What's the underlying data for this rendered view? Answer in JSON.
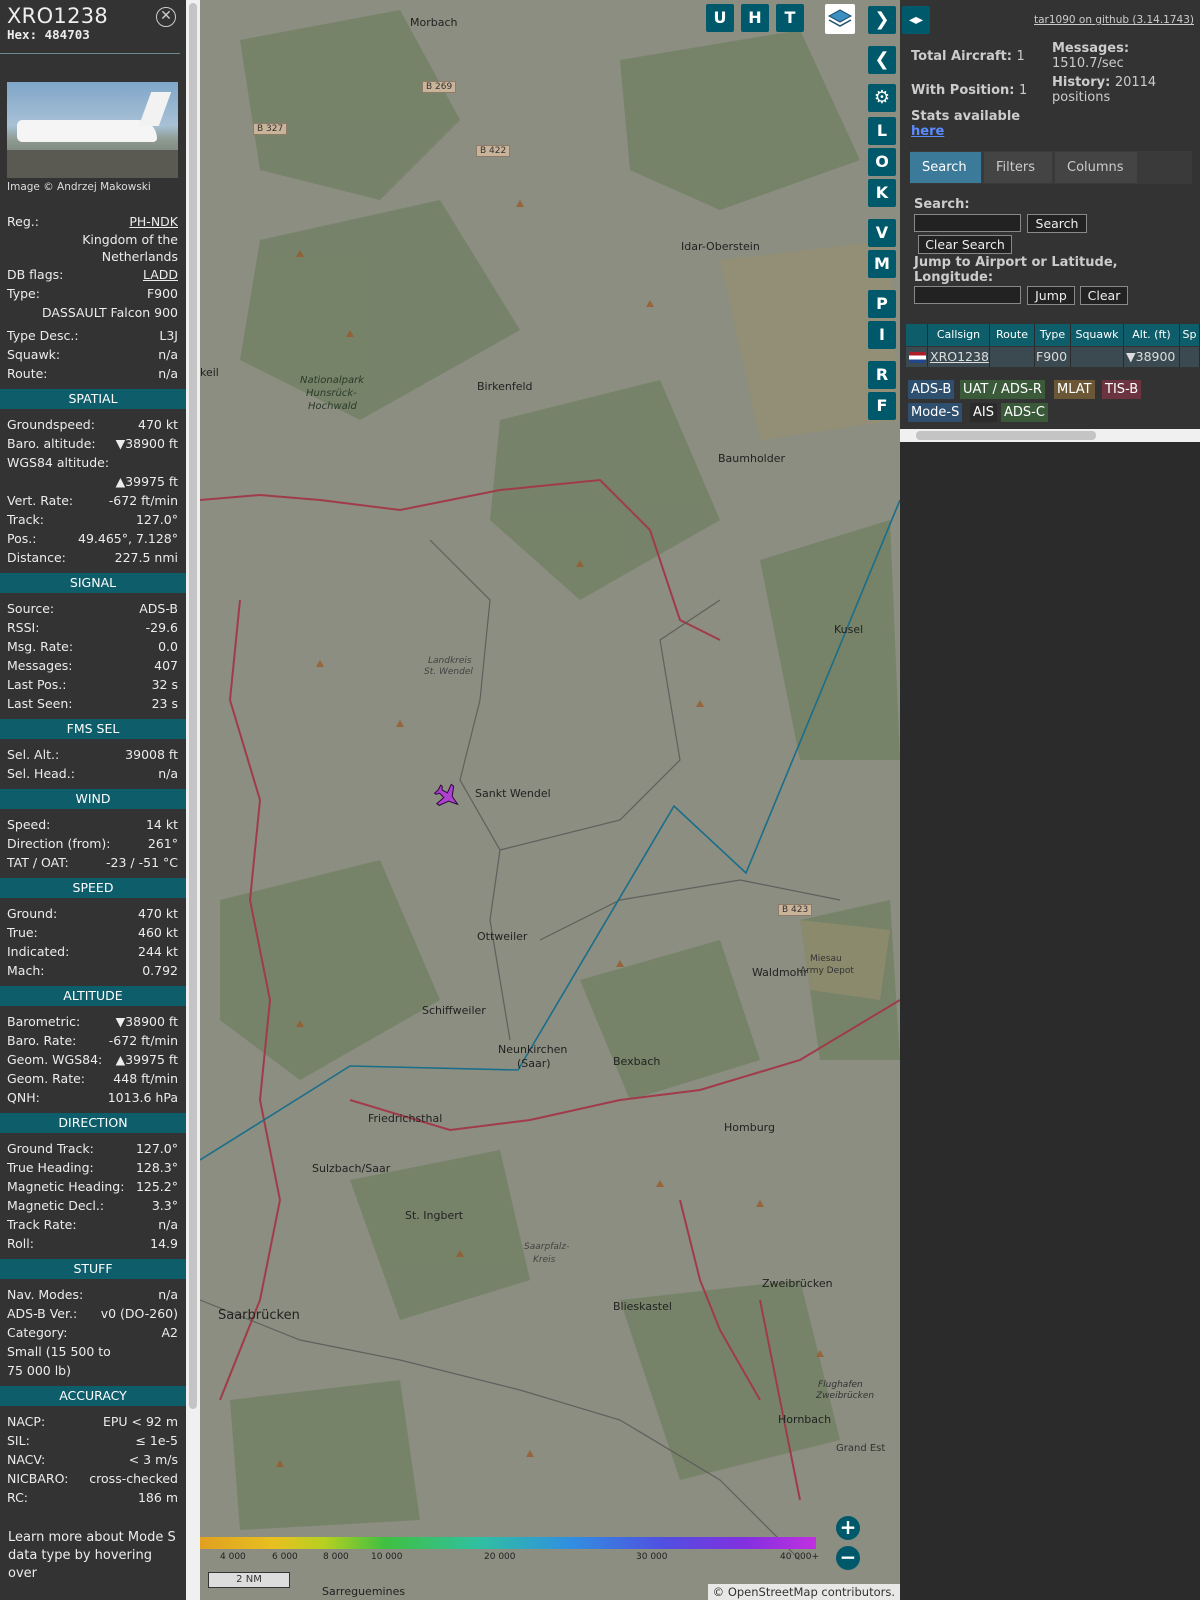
{
  "info": {
    "callsign": "XRO1238",
    "hex": "Hex: 484703",
    "photo_credit": "Image © Andrzej Makowski",
    "reg_label": "Reg.:",
    "reg_value": "PH-NDK",
    "country": "Kingdom of the Netherlands",
    "dbflags_label": "DB flags:",
    "dbflags_value": "LADD",
    "type_label": "Type:",
    "type_value": "F900",
    "type_full": "DASSAULT Falcon 900",
    "typedesc_label": "Type Desc.:",
    "typedesc_value": "L3J",
    "squawk_label": "Squawk:",
    "squawk_value": "n/a",
    "route_label": "Route:",
    "route_value": "n/a"
  },
  "sections": [
    {
      "title": "SPATIAL",
      "rows": [
        [
          "Groundspeed:",
          "470 kt"
        ],
        [
          "Baro. altitude:",
          "▼38900 ft"
        ],
        [
          "WGS84 altitude:",
          ""
        ],
        [
          "",
          "▲39975 ft"
        ],
        [
          "Vert. Rate:",
          "-672 ft/min"
        ],
        [
          "Track:",
          "127.0°"
        ],
        [
          "Pos.:",
          "49.465°, 7.128°"
        ],
        [
          "Distance:",
          "227.5 nmi"
        ]
      ]
    },
    {
      "title": "SIGNAL",
      "rows": [
        [
          "Source:",
          "ADS-B"
        ],
        [
          "RSSI:",
          "-29.6"
        ],
        [
          "Msg. Rate:",
          "0.0"
        ],
        [
          "Messages:",
          "407"
        ],
        [
          "Last Pos.:",
          "32 s"
        ],
        [
          "Last Seen:",
          "23 s"
        ]
      ]
    },
    {
      "title": "FMS SEL",
      "rows": [
        [
          "Sel. Alt.:",
          "39008 ft"
        ],
        [
          "Sel. Head.:",
          "n/a"
        ]
      ]
    },
    {
      "title": "WIND",
      "rows": [
        [
          "Speed:",
          "14 kt"
        ],
        [
          "Direction (from):",
          "261°"
        ],
        [
          "TAT / OAT:",
          "-23 / -51 °C"
        ]
      ]
    },
    {
      "title": "SPEED",
      "rows": [
        [
          "Ground:",
          "470 kt"
        ],
        [
          "True:",
          "460 kt"
        ],
        [
          "Indicated:",
          "244 kt"
        ],
        [
          "Mach:",
          "0.792"
        ]
      ]
    },
    {
      "title": "ALTITUDE",
      "rows": [
        [
          "Barometric:",
          "▼38900 ft"
        ],
        [
          "Baro. Rate:",
          "-672 ft/min"
        ],
        [
          "Geom. WGS84:",
          "▲39975 ft"
        ],
        [
          "Geom. Rate:",
          "448 ft/min"
        ],
        [
          "QNH:",
          "1013.6 hPa"
        ]
      ]
    },
    {
      "title": "DIRECTION",
      "rows": [
        [
          "Ground Track:",
          "127.0°"
        ],
        [
          "True Heading:",
          "128.3°"
        ],
        [
          "Magnetic Heading:",
          "125.2°"
        ],
        [
          "Magnetic Decl.:",
          "3.3°"
        ],
        [
          "Track Rate:",
          "n/a"
        ],
        [
          "Roll:",
          "14.9"
        ]
      ]
    },
    {
      "title": "STUFF",
      "rows": [
        [
          "Nav. Modes:",
          "n/a"
        ],
        [
          "ADS-B Ver.:",
          "v0 (DO-260)"
        ],
        [
          "Category:",
          "A2"
        ],
        [
          "Small (15 500 to",
          ""
        ],
        [
          "75 000 lb)",
          ""
        ]
      ]
    },
    {
      "title": "ACCURACY",
      "rows": [
        [
          "NACP:",
          "EPU < 92 m"
        ],
        [
          "SIL:",
          "≤ 1e-5"
        ],
        [
          "NACV:",
          "< 3 m/s"
        ],
        [
          "NICBARO:",
          "cross-checked"
        ],
        [
          "RC:",
          "186 m"
        ]
      ]
    }
  ],
  "footer_text": [
    "Learn more about Mode S",
    "data type by hovering over"
  ],
  "map": {
    "places": [
      [
        "Morbach"
      ],
      [
        "Idar-Oberstein"
      ],
      [
        "Birkenfeld"
      ],
      [
        "Baumholder"
      ],
      [
        "Kusel"
      ],
      [
        "Sankt Wendel"
      ],
      [
        "Ottweiler"
      ],
      [
        "Waldmohr"
      ],
      [
        "Schiffweiler"
      ],
      [
        "Neunkirchen"
      ],
      [
        "(Saar)"
      ],
      [
        "Bexbach"
      ],
      [
        "Homburg"
      ],
      [
        "Friedrichsthal"
      ],
      [
        "Sulzbach/Saar"
      ],
      [
        "St. Ingbert"
      ],
      [
        "Blieskastel"
      ],
      [
        "Zweibrücken"
      ],
      [
        "Saarbrücken"
      ],
      [
        "Hornbach"
      ],
      [
        "Sarreguemines"
      ],
      [
        "Nationalpark"
      ],
      [
        "Hunsrück-"
      ],
      [
        "Hochwald"
      ],
      [
        "Landkreis"
      ],
      [
        "St. Wendel"
      ],
      [
        "Saarpfalz-"
      ],
      [
        "Kreis"
      ],
      [
        "Miesau"
      ],
      [
        "Army Depot"
      ],
      [
        "Flughafen"
      ],
      [
        "Zweibrücken"
      ],
      [
        "Grand Est"
      ],
      [
        "keil"
      ]
    ],
    "roads": [
      "B 269",
      "B 327",
      "B 422",
      "B 423"
    ],
    "buttons": [
      "U",
      "H",
      "T"
    ],
    "side_buttons": [
      "L",
      "O",
      "K",
      "V",
      "M",
      "P",
      "I",
      "R",
      "F"
    ],
    "altitude_scale": [
      "4 000",
      "6 000",
      "8 000",
      "10 000",
      "20 000",
      "30 000",
      "40 000+"
    ],
    "scale_nm": "2 NM",
    "attribution_left": "© ",
    "attribution_link": "OpenStreetMap",
    "attribution_right": " contributors."
  },
  "right": {
    "github": "tar1090 on github (3.14.1743)",
    "total_aircraft_label": "Total Aircraft:",
    "total_aircraft": "1",
    "with_position_label": "With Position:",
    "with_position": "1",
    "messages_label": "Messages:",
    "messages_value": "1510.7/sec",
    "history_label": "History:",
    "history_value": "20114",
    "history_unit": "positions",
    "stats_label": "Stats available",
    "stats_link": "here",
    "tabs": [
      "Search",
      "Filters",
      "Columns"
    ],
    "search_label": "Search:",
    "search_btn": "Search",
    "clear_search_btn": "Clear Search",
    "jump_label": "Jump to Airport or Latitude, Longitude:",
    "jump_btn": "Jump",
    "clear_btn": "Clear",
    "columns": [
      "Callsign",
      "Route",
      "Type",
      "Squawk",
      "Alt. (ft)",
      "Sp"
    ],
    "row": {
      "callsign": "XRO1238",
      "route": "",
      "type": "F900",
      "squawk": "",
      "alt": "▼38900"
    },
    "legend": [
      {
        "label": "ADS-B",
        "color": "#2f4f6f"
      },
      {
        "label": "UAT / ADS-R",
        "color": "#3a5a3a"
      },
      {
        "label": "MLAT",
        "color": "#6b5735"
      },
      {
        "label": "TIS-B",
        "color": "#6b3440"
      },
      {
        "label": "Mode-S",
        "color": "#2f4f6f"
      },
      {
        "label": "AIS",
        "color": "#2b2b2b"
      },
      {
        "label": "ADS-C",
        "color": "#3a5a3a"
      }
    ]
  },
  "colors": {
    "accent": "#0e5d6a",
    "button": "#00596b",
    "track": "#1a6e8a"
  }
}
